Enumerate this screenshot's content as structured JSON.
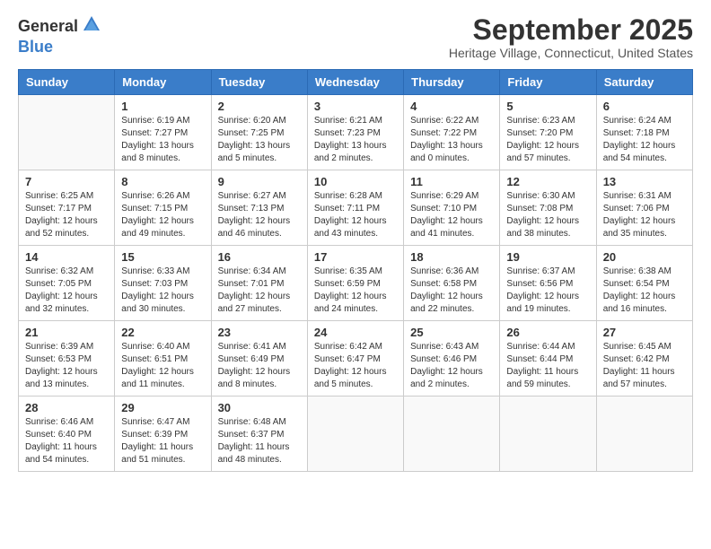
{
  "header": {
    "logo_general": "General",
    "logo_blue": "Blue",
    "month_title": "September 2025",
    "location": "Heritage Village, Connecticut, United States"
  },
  "days_of_week": [
    "Sunday",
    "Monday",
    "Tuesday",
    "Wednesday",
    "Thursday",
    "Friday",
    "Saturday"
  ],
  "weeks": [
    [
      {
        "day": "",
        "sunrise": "",
        "sunset": "",
        "daylight": ""
      },
      {
        "day": "1",
        "sunrise": "Sunrise: 6:19 AM",
        "sunset": "Sunset: 7:27 PM",
        "daylight": "Daylight: 13 hours and 8 minutes."
      },
      {
        "day": "2",
        "sunrise": "Sunrise: 6:20 AM",
        "sunset": "Sunset: 7:25 PM",
        "daylight": "Daylight: 13 hours and 5 minutes."
      },
      {
        "day": "3",
        "sunrise": "Sunrise: 6:21 AM",
        "sunset": "Sunset: 7:23 PM",
        "daylight": "Daylight: 13 hours and 2 minutes."
      },
      {
        "day": "4",
        "sunrise": "Sunrise: 6:22 AM",
        "sunset": "Sunset: 7:22 PM",
        "daylight": "Daylight: 13 hours and 0 minutes."
      },
      {
        "day": "5",
        "sunrise": "Sunrise: 6:23 AM",
        "sunset": "Sunset: 7:20 PM",
        "daylight": "Daylight: 12 hours and 57 minutes."
      },
      {
        "day": "6",
        "sunrise": "Sunrise: 6:24 AM",
        "sunset": "Sunset: 7:18 PM",
        "daylight": "Daylight: 12 hours and 54 minutes."
      }
    ],
    [
      {
        "day": "7",
        "sunrise": "Sunrise: 6:25 AM",
        "sunset": "Sunset: 7:17 PM",
        "daylight": "Daylight: 12 hours and 52 minutes."
      },
      {
        "day": "8",
        "sunrise": "Sunrise: 6:26 AM",
        "sunset": "Sunset: 7:15 PM",
        "daylight": "Daylight: 12 hours and 49 minutes."
      },
      {
        "day": "9",
        "sunrise": "Sunrise: 6:27 AM",
        "sunset": "Sunset: 7:13 PM",
        "daylight": "Daylight: 12 hours and 46 minutes."
      },
      {
        "day": "10",
        "sunrise": "Sunrise: 6:28 AM",
        "sunset": "Sunset: 7:11 PM",
        "daylight": "Daylight: 12 hours and 43 minutes."
      },
      {
        "day": "11",
        "sunrise": "Sunrise: 6:29 AM",
        "sunset": "Sunset: 7:10 PM",
        "daylight": "Daylight: 12 hours and 41 minutes."
      },
      {
        "day": "12",
        "sunrise": "Sunrise: 6:30 AM",
        "sunset": "Sunset: 7:08 PM",
        "daylight": "Daylight: 12 hours and 38 minutes."
      },
      {
        "day": "13",
        "sunrise": "Sunrise: 6:31 AM",
        "sunset": "Sunset: 7:06 PM",
        "daylight": "Daylight: 12 hours and 35 minutes."
      }
    ],
    [
      {
        "day": "14",
        "sunrise": "Sunrise: 6:32 AM",
        "sunset": "Sunset: 7:05 PM",
        "daylight": "Daylight: 12 hours and 32 minutes."
      },
      {
        "day": "15",
        "sunrise": "Sunrise: 6:33 AM",
        "sunset": "Sunset: 7:03 PM",
        "daylight": "Daylight: 12 hours and 30 minutes."
      },
      {
        "day": "16",
        "sunrise": "Sunrise: 6:34 AM",
        "sunset": "Sunset: 7:01 PM",
        "daylight": "Daylight: 12 hours and 27 minutes."
      },
      {
        "day": "17",
        "sunrise": "Sunrise: 6:35 AM",
        "sunset": "Sunset: 6:59 PM",
        "daylight": "Daylight: 12 hours and 24 minutes."
      },
      {
        "day": "18",
        "sunrise": "Sunrise: 6:36 AM",
        "sunset": "Sunset: 6:58 PM",
        "daylight": "Daylight: 12 hours and 22 minutes."
      },
      {
        "day": "19",
        "sunrise": "Sunrise: 6:37 AM",
        "sunset": "Sunset: 6:56 PM",
        "daylight": "Daylight: 12 hours and 19 minutes."
      },
      {
        "day": "20",
        "sunrise": "Sunrise: 6:38 AM",
        "sunset": "Sunset: 6:54 PM",
        "daylight": "Daylight: 12 hours and 16 minutes."
      }
    ],
    [
      {
        "day": "21",
        "sunrise": "Sunrise: 6:39 AM",
        "sunset": "Sunset: 6:53 PM",
        "daylight": "Daylight: 12 hours and 13 minutes."
      },
      {
        "day": "22",
        "sunrise": "Sunrise: 6:40 AM",
        "sunset": "Sunset: 6:51 PM",
        "daylight": "Daylight: 12 hours and 11 minutes."
      },
      {
        "day": "23",
        "sunrise": "Sunrise: 6:41 AM",
        "sunset": "Sunset: 6:49 PM",
        "daylight": "Daylight: 12 hours and 8 minutes."
      },
      {
        "day": "24",
        "sunrise": "Sunrise: 6:42 AM",
        "sunset": "Sunset: 6:47 PM",
        "daylight": "Daylight: 12 hours and 5 minutes."
      },
      {
        "day": "25",
        "sunrise": "Sunrise: 6:43 AM",
        "sunset": "Sunset: 6:46 PM",
        "daylight": "Daylight: 12 hours and 2 minutes."
      },
      {
        "day": "26",
        "sunrise": "Sunrise: 6:44 AM",
        "sunset": "Sunset: 6:44 PM",
        "daylight": "Daylight: 11 hours and 59 minutes."
      },
      {
        "day": "27",
        "sunrise": "Sunrise: 6:45 AM",
        "sunset": "Sunset: 6:42 PM",
        "daylight": "Daylight: 11 hours and 57 minutes."
      }
    ],
    [
      {
        "day": "28",
        "sunrise": "Sunrise: 6:46 AM",
        "sunset": "Sunset: 6:40 PM",
        "daylight": "Daylight: 11 hours and 54 minutes."
      },
      {
        "day": "29",
        "sunrise": "Sunrise: 6:47 AM",
        "sunset": "Sunset: 6:39 PM",
        "daylight": "Daylight: 11 hours and 51 minutes."
      },
      {
        "day": "30",
        "sunrise": "Sunrise: 6:48 AM",
        "sunset": "Sunset: 6:37 PM",
        "daylight": "Daylight: 11 hours and 48 minutes."
      },
      {
        "day": "",
        "sunrise": "",
        "sunset": "",
        "daylight": ""
      },
      {
        "day": "",
        "sunrise": "",
        "sunset": "",
        "daylight": ""
      },
      {
        "day": "",
        "sunrise": "",
        "sunset": "",
        "daylight": ""
      },
      {
        "day": "",
        "sunrise": "",
        "sunset": "",
        "daylight": ""
      }
    ]
  ]
}
